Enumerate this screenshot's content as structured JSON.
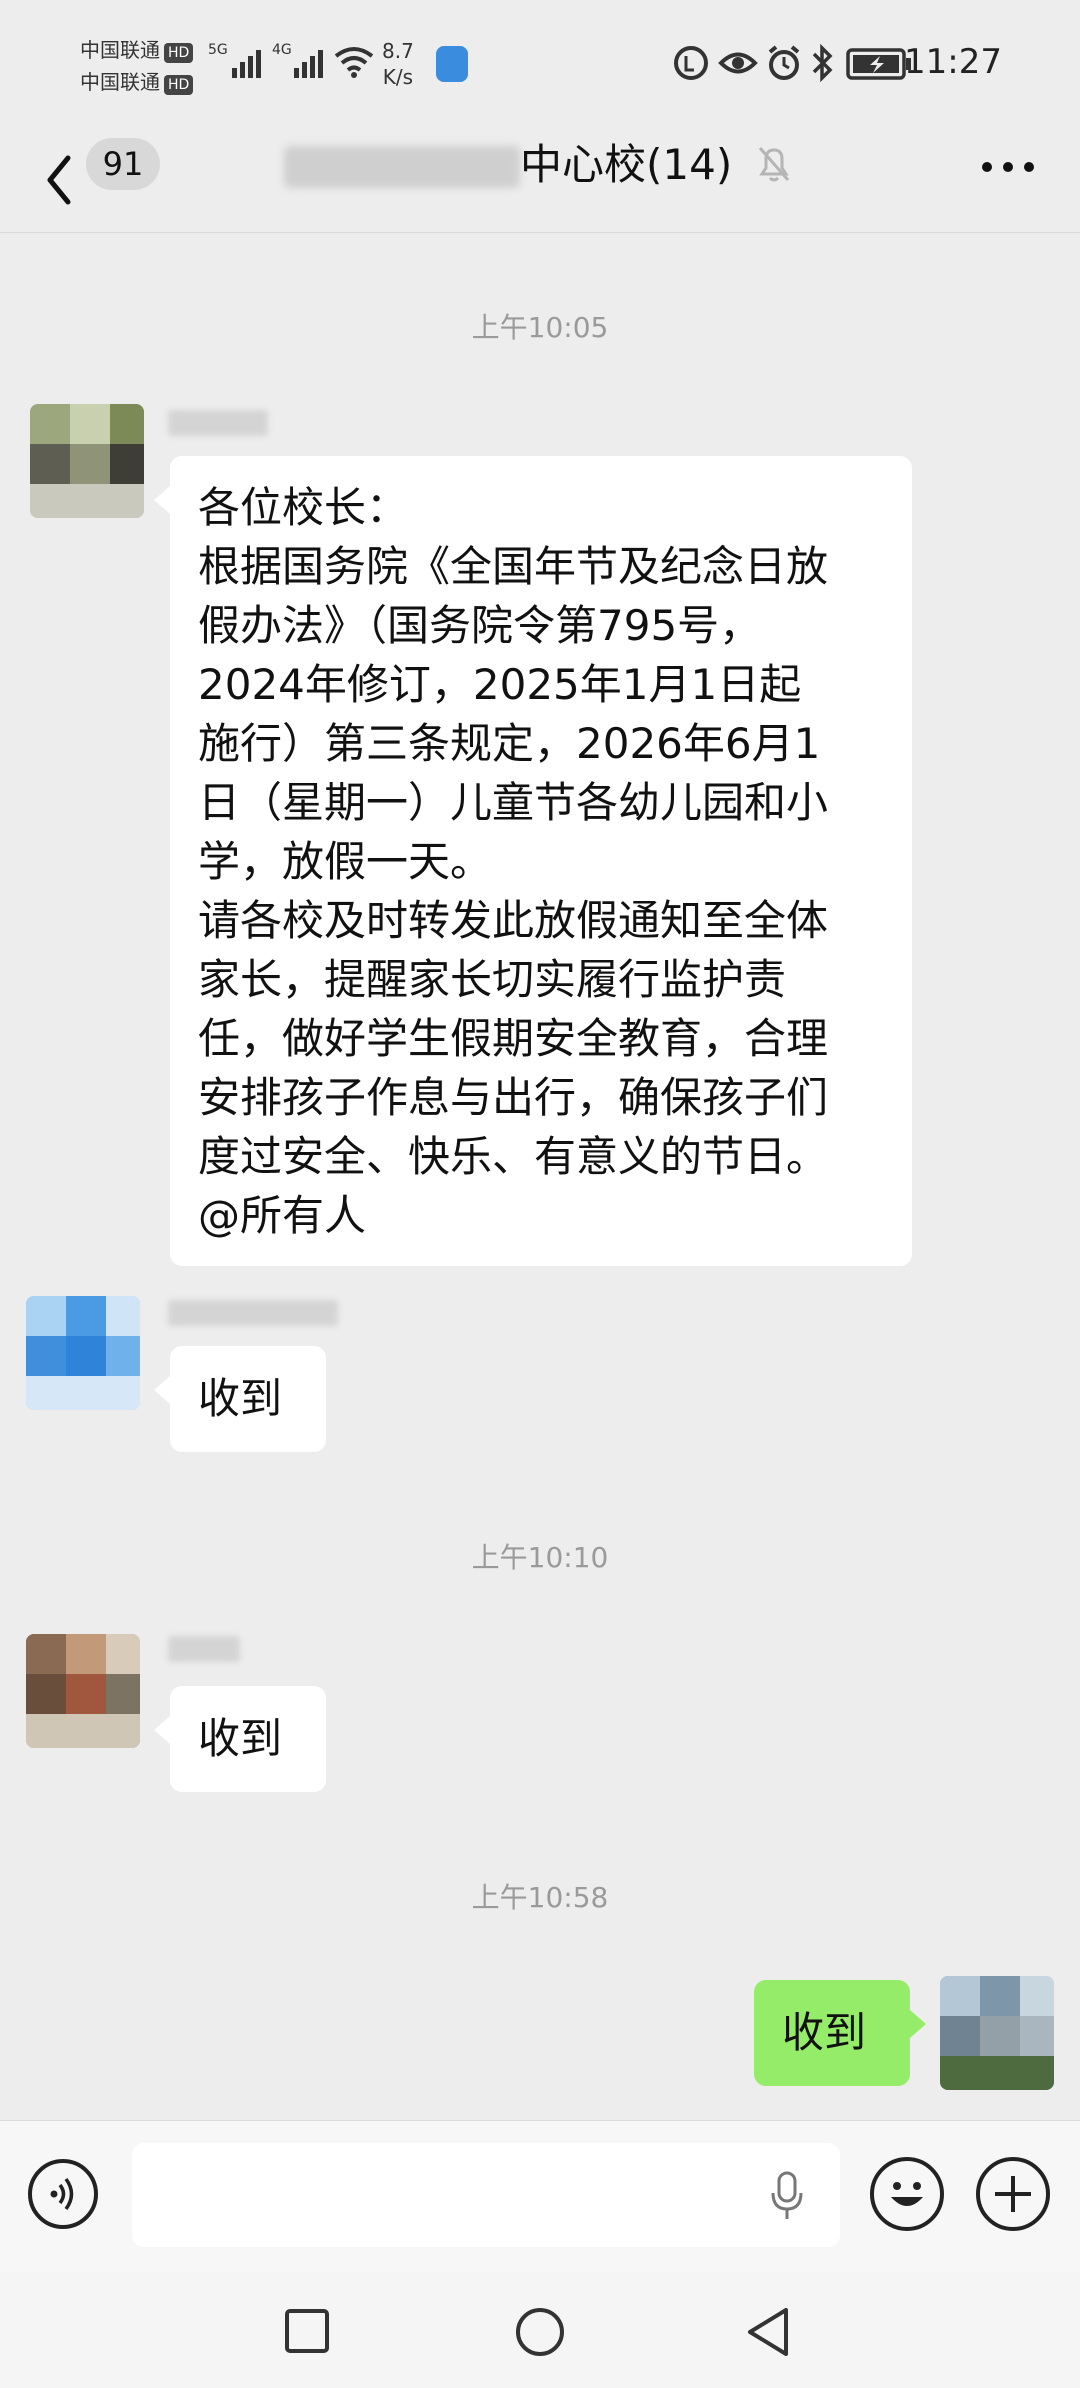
{
  "status_bar": {
    "carrier_1": "中国联通",
    "carrier_2": "中国联通",
    "hd_label": "HD",
    "signal_1": "5G",
    "signal_2": "4G",
    "net_speed_value": "8.7",
    "net_speed_unit": "K/s",
    "time": "11:27"
  },
  "header": {
    "unread_count": "91",
    "group_title_visible": "中心校(14)",
    "icons": [
      "back-chevron-icon",
      "mute-bell-icon",
      "more-dots-icon"
    ]
  },
  "chat": {
    "timestamps": [
      "上午10:05",
      "上午10:10",
      "上午10:58"
    ],
    "messages": [
      {
        "sender": "other",
        "lines": [
          "各位校长：",
          "根据国务院《全国年节及纪念日放",
          "假办法》（国务院令第795号，",
          "2024年修订，2025年1月1日起",
          "施行）第三条规定，2026年6月1",
          "日（星期一）儿童节各幼儿园和小",
          "学，放假一天。",
          "请各校及时转发此放假通知至全体",
          "家长，提醒家长切实履行监护责",
          "任，做好学生假期安全教育，合理",
          "安排孩子作息与出行，确保孩子们",
          "度过安全、快乐、有意义的节日。",
          "@所有人"
        ]
      },
      {
        "sender": "other",
        "text": "收到"
      },
      {
        "sender": "other",
        "text": "收到"
      },
      {
        "sender": "me",
        "text": "收到"
      }
    ]
  },
  "input_bar": {
    "icons": [
      "voice-icon",
      "microphone-icon",
      "emoji-icon",
      "plus-icon"
    ]
  },
  "nav_bar": {
    "icons": [
      "recents-square-icon",
      "home-circle-icon",
      "back-triangle-icon"
    ]
  },
  "colors": {
    "background": "#ededed",
    "bubble_other": "#ffffff",
    "bubble_mine": "#95ec69",
    "timestamp": "#9a9a9a"
  }
}
